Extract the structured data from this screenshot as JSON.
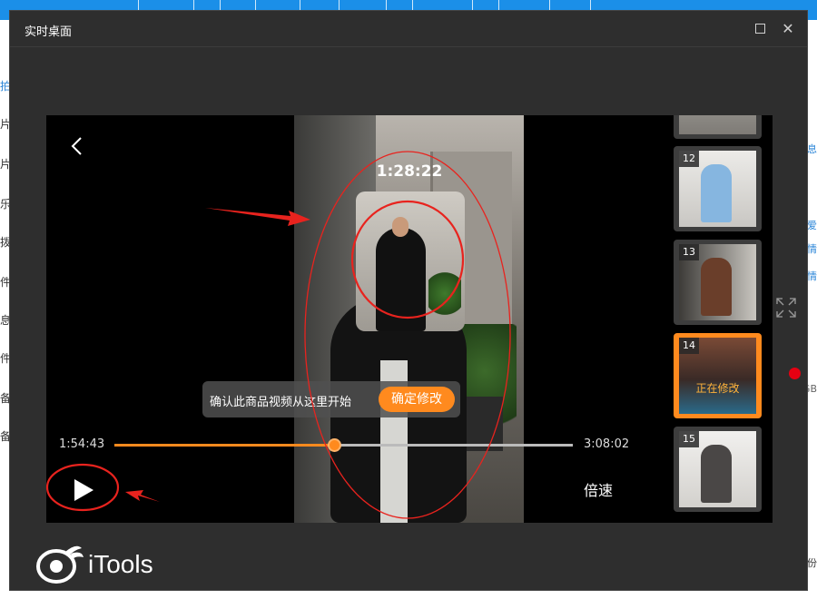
{
  "window": {
    "title": "实时桌面",
    "maximize_label": "",
    "close_label": "✕"
  },
  "background_app": {
    "left_items": [
      "拍",
      "片",
      "片",
      "乐",
      "拨",
      "件",
      "息",
      "件",
      "备",
      "备"
    ],
    "right_items": [
      "息",
      "爱",
      "情",
      "情",
      "GB",
      "份"
    ]
  },
  "player": {
    "clock": "1:28:22",
    "current_time": "1:54:43",
    "total_time": "3:08:02",
    "progress": 0.48,
    "confirm_text": "确认此商品视频从这里开始",
    "confirm_button": "确定修改",
    "speed_label": "倍速",
    "back_icon": "chevron-left-icon",
    "play_icon": "play-icon"
  },
  "thumbnails": [
    {
      "number": "12",
      "active": false,
      "editing_label": ""
    },
    {
      "number": "13",
      "active": false,
      "editing_label": ""
    },
    {
      "number": "14",
      "active": true,
      "editing_label": "正在修改"
    },
    {
      "number": "15",
      "active": false,
      "editing_label": ""
    }
  ],
  "brand": {
    "name": "iTools"
  },
  "colors": {
    "accent": "#ff8a1e",
    "annotation": "#e8231e",
    "window_bg": "#2e2e2e",
    "record": "#e60012"
  }
}
